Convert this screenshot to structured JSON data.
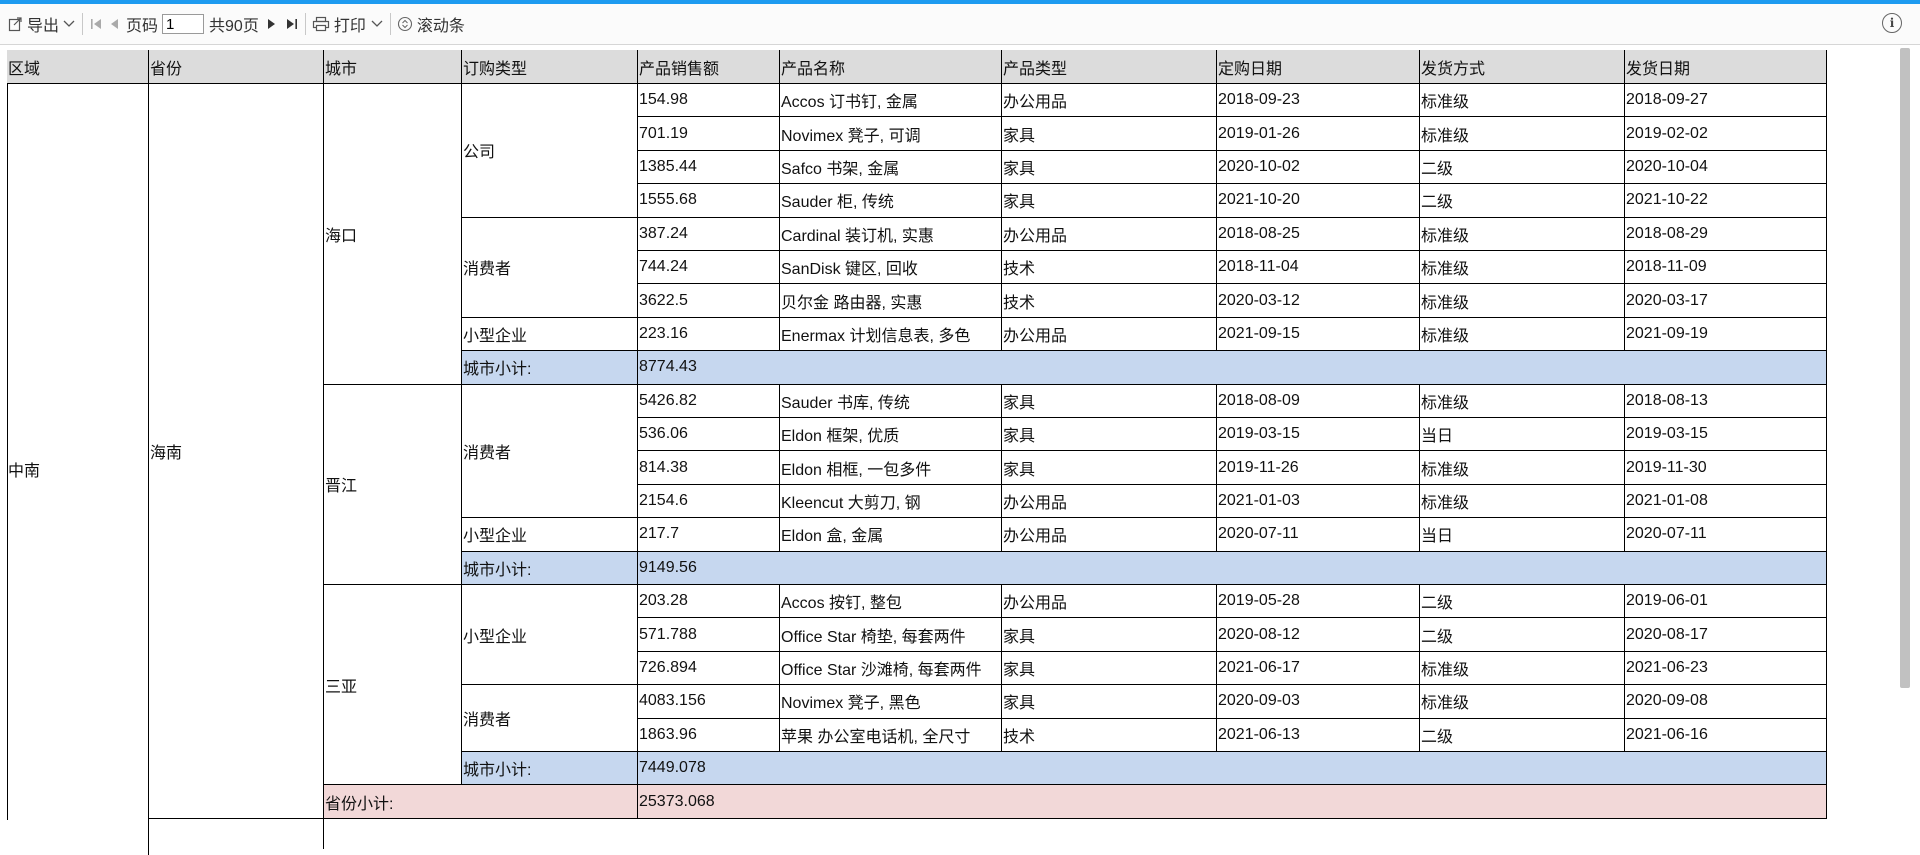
{
  "toolbar": {
    "export_label": "导出",
    "page_label": "页码",
    "page_value": "1",
    "total_pages": "共90页",
    "print_label": "打印",
    "scroll_label": "滚动条"
  },
  "headers": [
    "区域",
    "省份",
    "城市",
    "订购类型",
    "产品销售额",
    "产品名称",
    "产品类型",
    "定购日期",
    "发货方式",
    "发货日期"
  ],
  "region": "中南",
  "province": "海南",
  "city_subtotal_label": "城市小计:",
  "province_subtotal_label": "省份小计:",
  "province_subtotal_value": "25373.068",
  "cities": [
    {
      "name": "海口",
      "subtotal": "8774.43",
      "groups": [
        {
          "type": "公司",
          "rows": [
            [
              "154.98",
              "Accos 订书钉, 金属",
              "办公用品",
              "2018-09-23",
              "标准级",
              "2018-09-27"
            ],
            [
              "701.19",
              "Novimex 凳子, 可调",
              "家具",
              "2019-01-26",
              "标准级",
              "2019-02-02"
            ],
            [
              "1385.44",
              "Safco 书架, 金属",
              "家具",
              "2020-10-02",
              "二级",
              "2020-10-04"
            ],
            [
              "1555.68",
              "Sauder 柜, 传统",
              "家具",
              "2021-10-20",
              "二级",
              "2021-10-22"
            ]
          ]
        },
        {
          "type": "消费者",
          "rows": [
            [
              "387.24",
              "Cardinal 装订机, 实惠",
              "办公用品",
              "2018-08-25",
              "标准级",
              "2018-08-29"
            ],
            [
              "744.24",
              "SanDisk 键区, 回收",
              "技术",
              "2018-11-04",
              "标准级",
              "2018-11-09"
            ],
            [
              "3622.5",
              "贝尔金 路由器, 实惠",
              "技术",
              "2020-03-12",
              "标准级",
              "2020-03-17"
            ]
          ]
        },
        {
          "type": "小型企业",
          "rows": [
            [
              "223.16",
              "Enermax 计划信息表, 多色",
              "办公用品",
              "2021-09-15",
              "标准级",
              "2021-09-19"
            ]
          ]
        }
      ]
    },
    {
      "name": "晋江",
      "subtotal": "9149.56",
      "groups": [
        {
          "type": "消费者",
          "rows": [
            [
              "5426.82",
              "Sauder 书库, 传统",
              "家具",
              "2018-08-09",
              "标准级",
              "2018-08-13"
            ],
            [
              "536.06",
              "Eldon 框架, 优质",
              "家具",
              "2019-03-15",
              "当日",
              "2019-03-15"
            ],
            [
              "814.38",
              "Eldon 相框, 一包多件",
              "家具",
              "2019-11-26",
              "标准级",
              "2019-11-30"
            ],
            [
              "2154.6",
              "Kleencut 大剪刀, 钢",
              "办公用品",
              "2021-01-03",
              "标准级",
              "2021-01-08"
            ]
          ]
        },
        {
          "type": "小型企业",
          "rows": [
            [
              "217.7",
              "Eldon 盒, 金属",
              "办公用品",
              "2020-07-11",
              "当日",
              "2020-07-11"
            ]
          ]
        }
      ]
    },
    {
      "name": "三亚",
      "subtotal": "7449.078",
      "groups": [
        {
          "type": "小型企业",
          "rows": [
            [
              "203.28",
              "Accos 按钉, 整包",
              "办公用品",
              "2019-05-28",
              "二级",
              "2019-06-01"
            ],
            [
              "571.788",
              "Office Star 椅垫, 每套两件",
              "家具",
              "2020-08-12",
              "二级",
              "2020-08-17"
            ],
            [
              "726.894",
              "Office Star 沙滩椅, 每套两件",
              "家具",
              "2021-06-17",
              "标准级",
              "2021-06-23"
            ]
          ]
        },
        {
          "type": "消费者",
          "rows": [
            [
              "4083.156",
              "Novimex 凳子, 黑色",
              "家具",
              "2020-09-03",
              "标准级",
              "2020-09-08"
            ],
            [
              "1863.96",
              "苹果 办公室电话机, 全尺寸",
              "技术",
              "2021-06-13",
              "二级",
              "2021-06-16"
            ]
          ]
        }
      ]
    }
  ]
}
